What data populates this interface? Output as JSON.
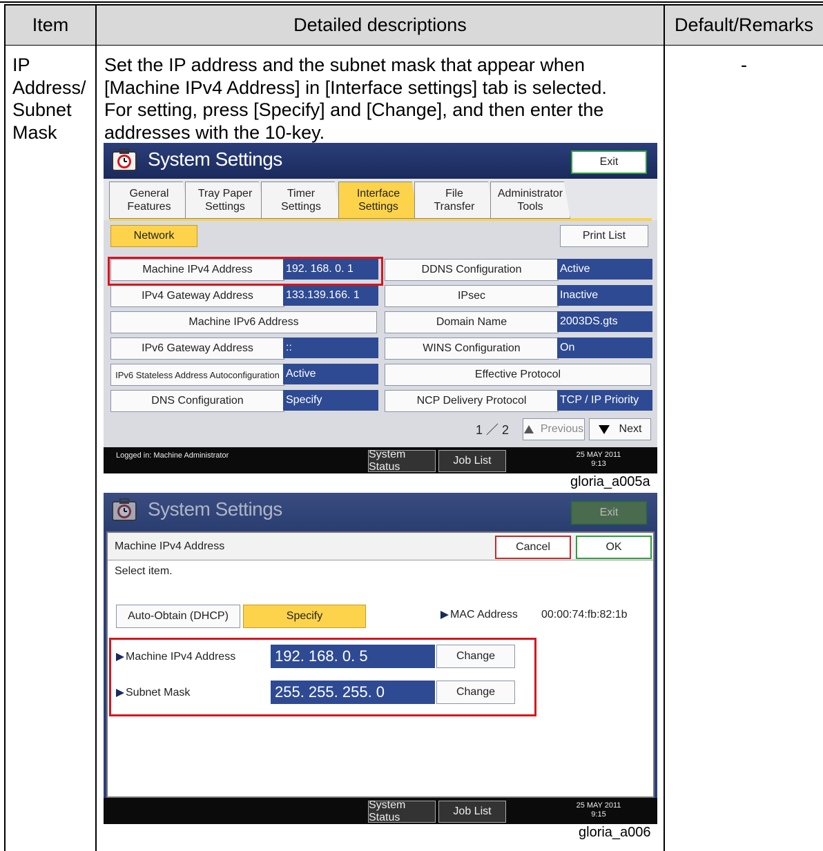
{
  "table": {
    "headers": [
      "Item",
      "Detailed descriptions",
      "Default/Remarks"
    ],
    "item_lines": [
      "IP",
      "Address/",
      "Subnet",
      "Mask"
    ],
    "description_lines": [
      "Set the IP address and the subnet mask that appear when",
      "[Machine IPv4 Address] in [Interface settings] tab is selected.",
      "For setting, press [Specify] and [Change], and then enter the",
      "addresses with the 10-key."
    ],
    "remarks": "-"
  },
  "screen1": {
    "title": "System Settings",
    "exit": "Exit",
    "tabs": [
      {
        "line1": "General",
        "line2": "Features"
      },
      {
        "line1": "Tray Paper",
        "line2": "Settings"
      },
      {
        "line1": "Timer",
        "line2": "Settings"
      },
      {
        "line1": "Interface",
        "line2": "Settings"
      },
      {
        "line1": "File",
        "line2": "Transfer"
      },
      {
        "line1": "Administrator",
        "line2": "Tools"
      }
    ],
    "network": "Network",
    "print_list": "Print List",
    "left_rows": [
      {
        "label": "Machine IPv4 Address",
        "value": "192. 168.  0.   1"
      },
      {
        "label": "IPv4 Gateway Address",
        "value": "133.139.166.   1"
      },
      {
        "label": "Machine IPv6 Address",
        "value": ""
      },
      {
        "label": "IPv6 Gateway Address",
        "value": "::"
      },
      {
        "label": "IPv6 Stateless Address Autoconfiguration",
        "value": "Active"
      },
      {
        "label": "DNS Configuration",
        "value": "Specify"
      }
    ],
    "right_rows": [
      {
        "label": "DDNS Configuration",
        "value": "Active"
      },
      {
        "label": "IPsec",
        "value": "Inactive"
      },
      {
        "label": "Domain Name",
        "value": "2003DS.gts"
      },
      {
        "label": "WINS Configuration",
        "value": "On"
      },
      {
        "label": "Effective Protocol",
        "value": ""
      },
      {
        "label": "NCP Delivery Protocol",
        "value": "TCP / IP Priority"
      }
    ],
    "page": "1 ／ 2",
    "previous": "Previous",
    "next": "Next",
    "login": "Logged in:  Machine Administrator",
    "system_status": "System Status",
    "job_list": "Job List",
    "date": "25  MAY   2011",
    "time": "9:13",
    "caption": "gloria_a005a"
  },
  "screen2": {
    "title": "System Settings",
    "exit": "Exit",
    "header": "Machine IPv4 Address",
    "cancel": "Cancel",
    "ok": "OK",
    "prompt": "Select item.",
    "auto_obtain": "Auto-Obtain (DHCP)",
    "specify": "Specify",
    "mac_label": "MAC Address",
    "mac_value": "00:00:74:fb:82:1b",
    "ipv4_label": "Machine IPv4 Address",
    "ipv4_value": "192. 168.   0.   5",
    "subnet_label": "Subnet Mask",
    "subnet_value": "255. 255. 255.   0",
    "change": "Change",
    "system_status": "System Status",
    "job_list": "Job List",
    "date": "25  MAY   2011",
    "time": "9:15",
    "caption": "gloria_a006"
  }
}
